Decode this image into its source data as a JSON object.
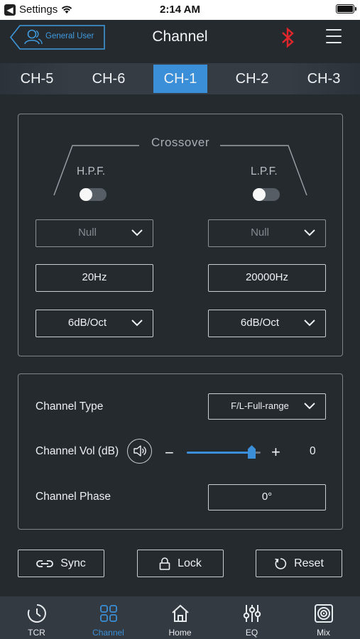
{
  "status_bar": {
    "back_app": "Settings",
    "time": "2:14 AM"
  },
  "header": {
    "user_label": "General User",
    "title": "Channel"
  },
  "tabs": [
    {
      "label": "CH-5",
      "active": false
    },
    {
      "label": "CH-6",
      "active": false
    },
    {
      "label": "CH-1",
      "active": true
    },
    {
      "label": "CH-2",
      "active": false
    },
    {
      "label": "CH-3",
      "active": false
    }
  ],
  "crossover": {
    "title": "Crossover",
    "hpf": {
      "label": "H.P.F.",
      "enabled": false,
      "type": "Null",
      "frequency": "20Hz",
      "slope": "6dB/Oct"
    },
    "lpf": {
      "label": "L.P.F.",
      "enabled": false,
      "type": "Null",
      "frequency": "20000Hz",
      "slope": "6dB/Oct"
    }
  },
  "channel_settings": {
    "type_label": "Channel Type",
    "type_value": "F/L-Full-range",
    "vol_label": "Channel Vol (dB)",
    "vol_value": "0",
    "vol_level_percent": 88,
    "minus": "−",
    "plus": "+",
    "phase_label": "Channel Phase",
    "phase_value": "0°"
  },
  "actions": {
    "sync": "Sync",
    "lock": "Lock",
    "reset": "Reset"
  },
  "bottom_nav": [
    {
      "label": "TCR",
      "icon": "clock-icon",
      "active": false
    },
    {
      "label": "Channel",
      "icon": "grid-icon",
      "active": true
    },
    {
      "label": "Home",
      "icon": "home-icon",
      "active": false
    },
    {
      "label": "EQ",
      "icon": "equalizer-icon",
      "active": false
    },
    {
      "label": "Mix",
      "icon": "speaker-mix-icon",
      "active": false
    }
  ],
  "colors": {
    "accent": "#3a8fd8",
    "bluetooth": "#e0262b",
    "background": "#252a2f"
  }
}
